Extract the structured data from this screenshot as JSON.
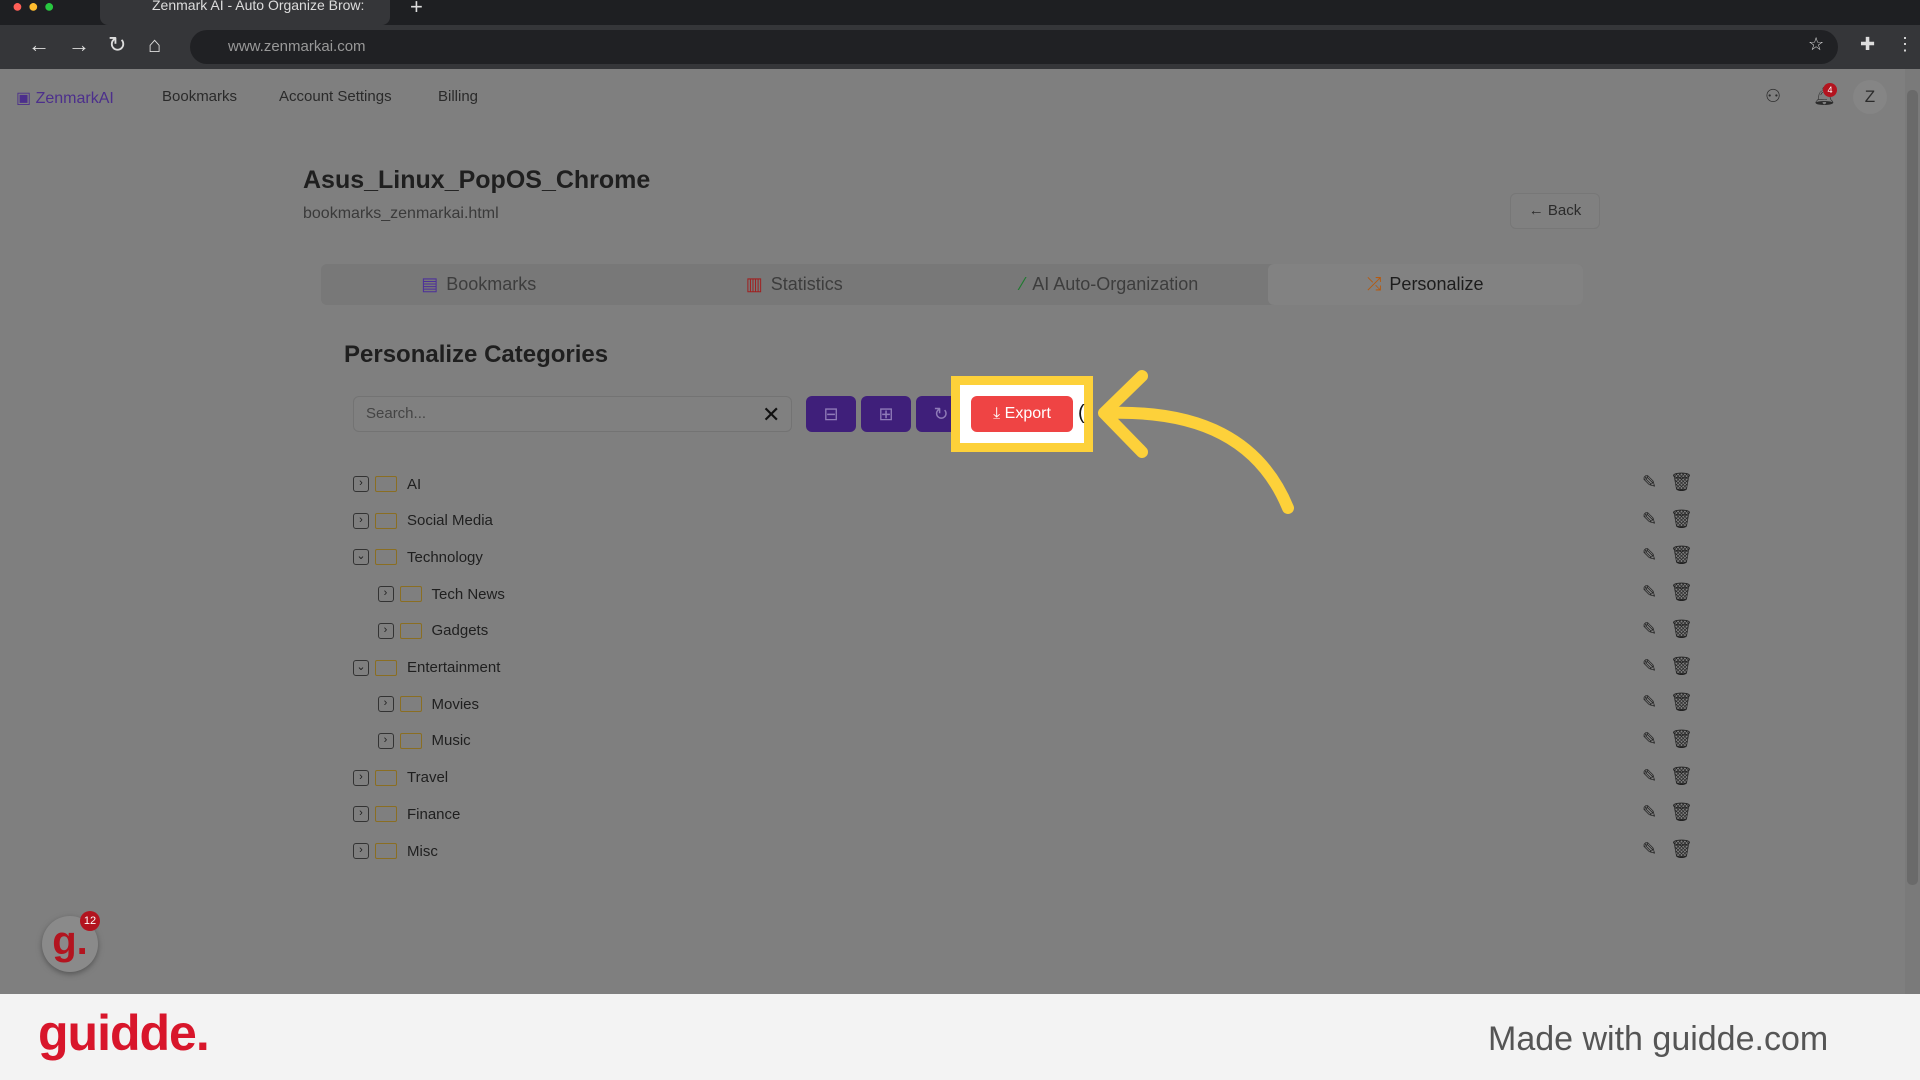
{
  "browser": {
    "tab_title": "Zenmark AI - Auto Organize Brow:",
    "url": "www.zenmarkai.com"
  },
  "nav": {
    "logo": "ZenmarkAI",
    "links": [
      "Bookmarks",
      "Account Settings",
      "Billing"
    ],
    "notification_count": "4",
    "avatar": "Z"
  },
  "header": {
    "title": "Asus_Linux_PopOS_Chrome",
    "subtitle": "bookmarks_zenmarkai.html",
    "back_label": "Back"
  },
  "tabs": [
    {
      "label": "Bookmarks",
      "icon": "bookmark-icon",
      "color": "#4c2f9a"
    },
    {
      "label": "Statistics",
      "icon": "bar-chart-icon",
      "color": "#a02020"
    },
    {
      "label": "AI Auto-Organization",
      "icon": "magic-wand-icon",
      "color": "#1f7a2f"
    },
    {
      "label": "Personalize",
      "icon": "shuffle-icon",
      "color": "#b55a10",
      "active": true
    }
  ],
  "section": {
    "title": "Personalize Categories",
    "search_placeholder": "Search...",
    "export_label": "Export"
  },
  "categories": [
    {
      "label": "AI",
      "level": 0,
      "expanded": false
    },
    {
      "label": "Social Media",
      "level": 0,
      "expanded": false
    },
    {
      "label": "Technology",
      "level": 0,
      "expanded": true
    },
    {
      "label": "Tech News",
      "level": 1,
      "expanded": false
    },
    {
      "label": "Gadgets",
      "level": 1,
      "expanded": false
    },
    {
      "label": "Entertainment",
      "level": 0,
      "expanded": true
    },
    {
      "label": "Movies",
      "level": 1,
      "expanded": false
    },
    {
      "label": "Music",
      "level": 1,
      "expanded": false
    },
    {
      "label": "Travel",
      "level": 0,
      "expanded": false
    },
    {
      "label": "Finance",
      "level": 0,
      "expanded": false
    },
    {
      "label": "Misc",
      "level": 0,
      "expanded": false
    }
  ],
  "footer": {
    "brand": "guidde.",
    "made_with": "Made with guidde.com",
    "badge_count": "12"
  },
  "colors": {
    "highlight": "#fdd13a",
    "export": "#ef4444",
    "primary": "#3f1f7a"
  }
}
